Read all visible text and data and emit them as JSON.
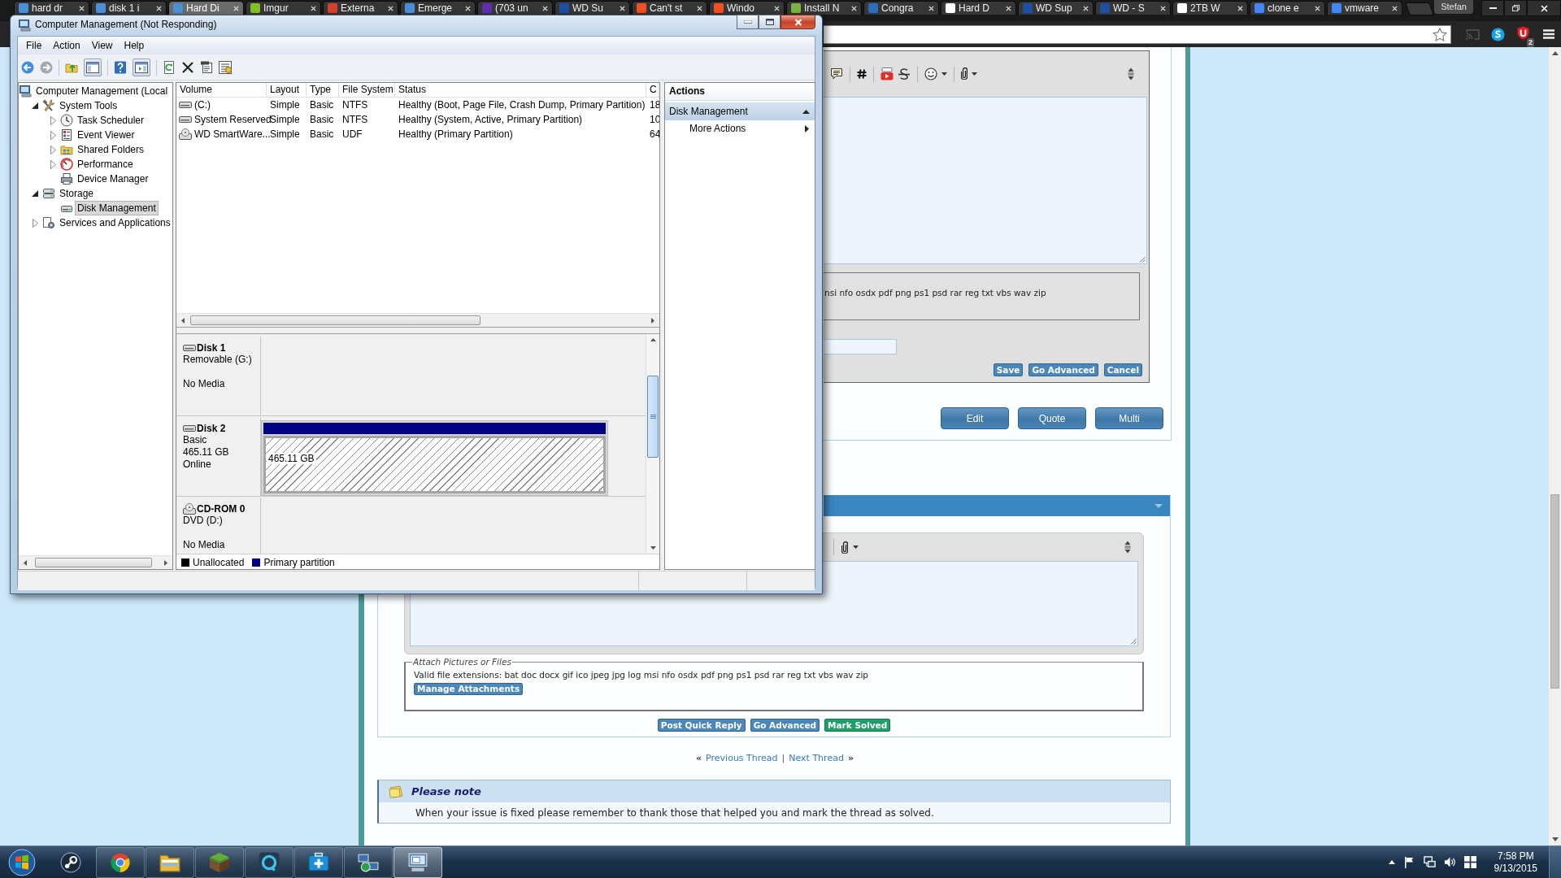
{
  "browser": {
    "tabs": [
      {
        "title": "hard dr",
        "color": "#4a90d9",
        "selected": false
      },
      {
        "title": "disk 1 i",
        "color": "#4a90d9",
        "selected": false
      },
      {
        "title": "Hard Di",
        "color": "#4a90d9",
        "selected": true
      },
      {
        "title": "Imgur",
        "color": "#85bf25",
        "selected": false
      },
      {
        "title": "Externa",
        "color": "#d9402b",
        "selected": false
      },
      {
        "title": "Emerge",
        "color": "#4a90d9",
        "selected": false
      },
      {
        "title": "(703 un",
        "color": "#5f2eb3",
        "selected": false
      },
      {
        "title": "WD Su",
        "color": "#1e4fa0",
        "selected": false
      },
      {
        "title": "Can't st",
        "color": "#f25022",
        "selected": false
      },
      {
        "title": "Windo",
        "color": "#f25022",
        "selected": false
      },
      {
        "title": "Install N",
        "color": "#7cb342",
        "selected": false
      },
      {
        "title": "Congra",
        "color": "#2a6ebb",
        "selected": false
      },
      {
        "title": "Hard D",
        "color": "#ffffff",
        "selected": false
      },
      {
        "title": "WD Sup",
        "color": "#1e4fa0",
        "selected": false
      },
      {
        "title": "WD - S",
        "color": "#1e4fa0",
        "selected": false
      },
      {
        "title": "2TB W",
        "color": "#ffffff",
        "selected": false
      },
      {
        "title": "clone e",
        "color": "#4285f4",
        "selected": false
      },
      {
        "title": "vmware",
        "color": "#4285f4",
        "selected": false
      }
    ],
    "profile": "Stefan",
    "extension_badge": "2"
  },
  "forum": {
    "edit_editor": {
      "extensions_text": "nsi nfo osdx pdf png ps1 psd rar reg txt vbs wav zip",
      "buttons": [
        "Save",
        "Go Advanced",
        "Cancel"
      ]
    },
    "post_buttons": [
      "Edit",
      "Quote",
      "Multi"
    ],
    "quick_reply": {
      "legend": "Attach Pictures or Files",
      "extensions_text": "Valid file extensions: bat doc docx gif ico jpeg jpg log msi nfo osdx pdf png ps1 psd rar reg txt vbs wav zip",
      "manage_button": "Manage Attachments",
      "buttons": [
        {
          "label": "Post Quick Reply",
          "kind": "primary"
        },
        {
          "label": "Go Advanced",
          "kind": "primary"
        },
        {
          "label": "Mark Solved",
          "kind": "success"
        }
      ]
    },
    "thread_nav": {
      "previous_mark": "«",
      "previous": "Previous Thread",
      "separator": "|",
      "next": "Next Thread",
      "next_mark": "»"
    },
    "note": {
      "title": "Please note",
      "text": "When your issue is fixed please remember to thank those that helped you and mark the thread as solved."
    }
  },
  "window": {
    "title": "Computer Management (Not Responding)",
    "menu": [
      "File",
      "Action",
      "View",
      "Help"
    ],
    "toolbar_toggles": [
      {
        "on": true
      },
      {
        "on": true
      }
    ],
    "tree": [
      {
        "label": "Computer Management (Local",
        "selected": false,
        "children": [
          {
            "label": "System Tools",
            "expandable": true,
            "expanded": true,
            "selected": false,
            "children": [
              {
                "label": "Task Scheduler",
                "expandable": true,
                "expanded": false,
                "selected": false
              },
              {
                "label": "Event Viewer",
                "expandable": true,
                "expanded": false,
                "selected": false
              },
              {
                "label": "Shared Folders",
                "expandable": true,
                "expanded": false,
                "selected": false
              },
              {
                "label": "Performance",
                "expandable": true,
                "expanded": false,
                "selected": false
              },
              {
                "label": "Device Manager",
                "expandable": false,
                "expanded": false,
                "selected": false
              }
            ]
          },
          {
            "label": "Storage",
            "expandable": true,
            "expanded": true,
            "selected": false,
            "children": [
              {
                "label": "Disk Management",
                "expandable": false,
                "expanded": false,
                "selected": true
              }
            ]
          },
          {
            "label": "Services and Applications",
            "expandable": true,
            "expanded": false,
            "selected": false
          }
        ]
      }
    ],
    "volumes": {
      "columns": [
        "Volume",
        "Layout",
        "Type",
        "File System",
        "Status",
        "C"
      ],
      "rows": [
        {
          "kind": "disk",
          "cells": [
            "(C:)",
            "Simple",
            "Basic",
            "NTFS",
            "Healthy (Boot, Page File, Crash Dump, Primary Partition)",
            "18"
          ]
        },
        {
          "kind": "disk",
          "cells": [
            "System Reserved",
            "Simple",
            "Basic",
            "NTFS",
            "Healthy (System, Active, Primary Partition)",
            "10"
          ]
        },
        {
          "kind": "optical",
          "cells": [
            "WD SmartWare...",
            "Simple",
            "Basic",
            "UDF",
            "Healthy (Primary Partition)",
            "64"
          ]
        }
      ]
    },
    "disks": [
      {
        "kind": "disk",
        "name": "Disk 1",
        "type": "Removable (G:)",
        "status": "No Media"
      },
      {
        "kind": "disk",
        "name": "Disk 2",
        "type": "Basic",
        "size": "465.11 GB",
        "status": "Online",
        "partitions": [
          {
            "size": "465.11 GB",
            "color": "#000080",
            "selected": true
          }
        ]
      },
      {
        "kind": "optical",
        "name": "CD-ROM 0",
        "type": "DVD (D:)",
        "status": "No Media"
      }
    ],
    "legend": [
      {
        "label": "Unallocated",
        "color": "#000000"
      },
      {
        "label": "Primary partition",
        "color": "#000080"
      }
    ],
    "actions": {
      "title": "Actions",
      "sections": [
        {
          "label": "Disk Management",
          "expanded": true,
          "items": [
            {
              "label": "More Actions",
              "submenu": true
            }
          ]
        }
      ]
    }
  },
  "taskbar": {
    "buttons": [
      {
        "running": false,
        "selected": false
      },
      {
        "running": true,
        "selected": false
      },
      {
        "running": true,
        "selected": false
      },
      {
        "running": true,
        "selected": false
      },
      {
        "running": true,
        "selected": false
      },
      {
        "running": true,
        "selected": false
      },
      {
        "running": true,
        "selected": false
      },
      {
        "running": true,
        "selected": true
      }
    ],
    "time": "7:58 PM",
    "date": "9/13/2015"
  }
}
